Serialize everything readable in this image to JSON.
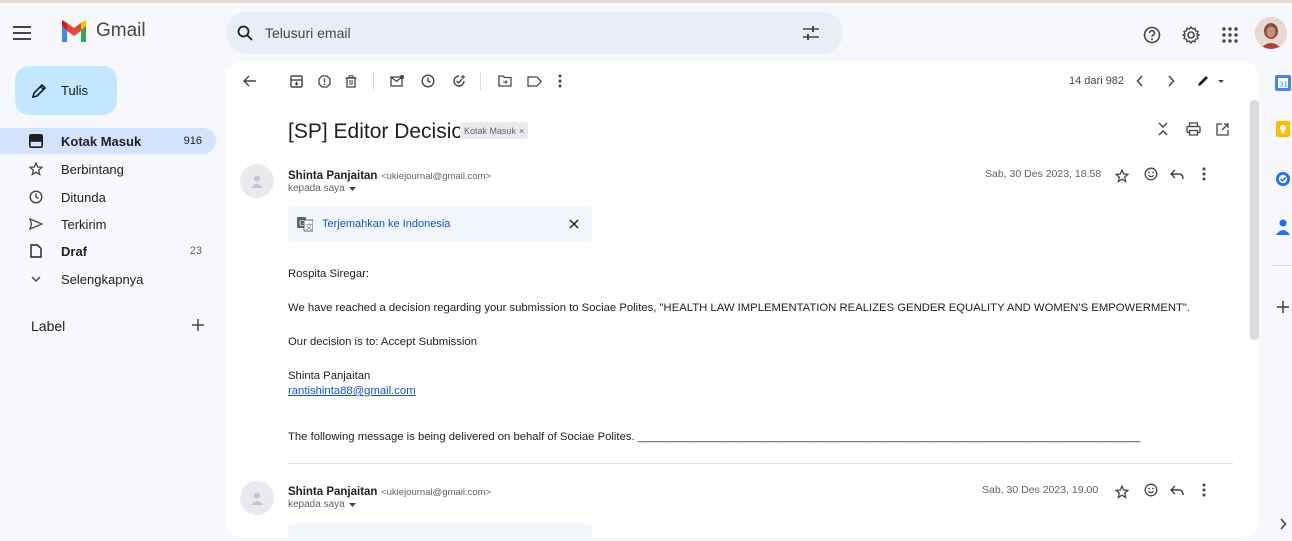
{
  "app": {
    "name": "Gmail"
  },
  "search": {
    "placeholder": "Telusuri email"
  },
  "sidebar": {
    "compose_label": "Tulis",
    "items": [
      {
        "label": "Kotak Masuk",
        "count": "916",
        "icon": "inbox-icon"
      },
      {
        "label": "Berbintang",
        "count": "",
        "icon": "star-icon"
      },
      {
        "label": "Ditunda",
        "count": "",
        "icon": "clock-icon"
      },
      {
        "label": "Terkirim",
        "count": "",
        "icon": "send-icon"
      },
      {
        "label": "Draf",
        "count": "23",
        "icon": "file-icon"
      },
      {
        "label": "Selengkapnya",
        "count": "",
        "icon": "chevron-down-icon"
      }
    ],
    "labels_heading": "Label"
  },
  "toolbar": {
    "pagination": "14 dari 982"
  },
  "thread": {
    "subject": "[SP] Editor Decision",
    "label_chip": "Kotak Masuk",
    "messages": [
      {
        "sender_name": "Shinta Panjaitan",
        "sender_email": "<ukiejournal@gmail.com>",
        "to": "kepada saya",
        "date": "Sab, 30 Des 2023, 18.58",
        "translate_label": "Terjemahkan ke Indonesia",
        "body": {
          "greeting": "Rospita Siregar:",
          "para1": "We have reached a decision regarding your submission to Sociae Polites, \"HEALTH LAW IMPLEMENTATION REALIZES GENDER EQUALITY AND WOMEN'S EMPOWERMENT\".",
          "para2": "Our decision is to: Accept Submission",
          "signature_name": "Shinta Panjaitan",
          "signature_email": "rantishinta88@gmail.com",
          "footer": "The following message is being delivered on behalf of Sociae Polites. ________________________________________________________________________________"
        }
      },
      {
        "sender_name": "Shinta Panjaitan",
        "sender_email": "<ukiejournal@gmail.com>",
        "to": "kepada saya",
        "date": "Sab, 30 Des 2023, 19.00"
      }
    ]
  }
}
